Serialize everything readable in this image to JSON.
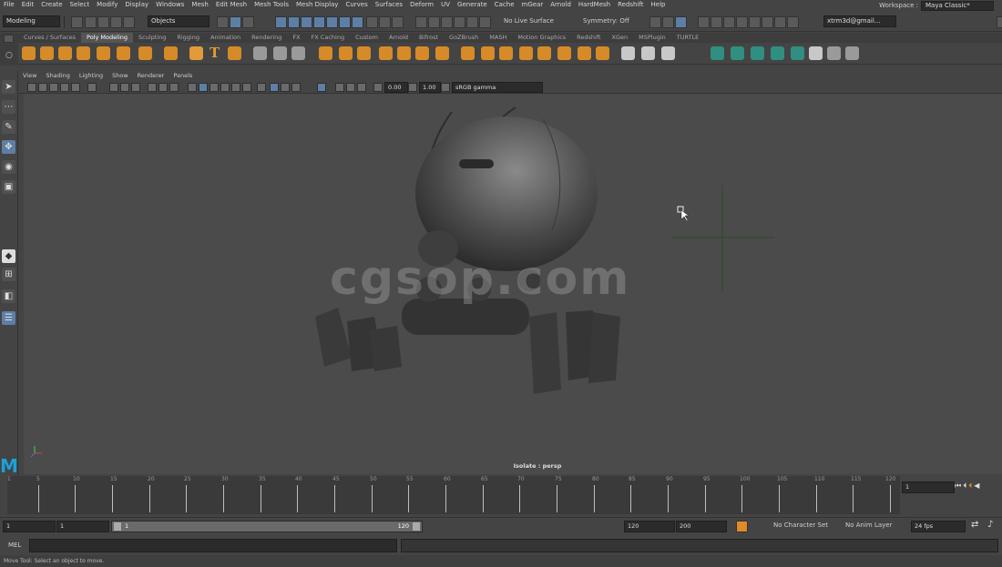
{
  "menu": [
    "File",
    "Edit",
    "Create",
    "Select",
    "Modify",
    "Display",
    "Windows",
    "Mesh",
    "Edit Mesh",
    "Mesh Tools",
    "Mesh Display",
    "Curves",
    "Surfaces",
    "Deform",
    "UV",
    "Generate",
    "Cache",
    "mGear",
    "Arnold",
    "HardMesh",
    "Redshift",
    "Help"
  ],
  "workspace": {
    "label": "Workspace :",
    "value": "Maya Classic*"
  },
  "status": {
    "mode": "Modeling",
    "objects": "Objects",
    "live_surface": "No Live Surface",
    "symmetry": "Symmetry: Off",
    "account": "xtrm3d@gmail..."
  },
  "shelf_tabs": [
    "Curves / Surfaces",
    "Poly Modeling",
    "Sculpting",
    "Rigging",
    "Animation",
    "Rendering",
    "FX",
    "FX Caching",
    "Custom",
    "Arnold",
    "Bifrost",
    "GoZBrush",
    "MASH",
    "Motion Graphics",
    "Redshift",
    "XGen",
    "MSPlugin",
    "TURTLE"
  ],
  "panel_menu": [
    "View",
    "Shading",
    "Lighting",
    "Show",
    "Renderer",
    "Panels"
  ],
  "panel_toolbar": {
    "exposure": "0.00",
    "gamma": "1.00",
    "color_space": "sRGB gamma"
  },
  "viewport": {
    "label": "Isolate : persp",
    "watermark": "cgsop.com"
  },
  "timeline": {
    "ticks": [
      "1",
      "5",
      "10",
      "15",
      "20",
      "25",
      "30",
      "35",
      "40",
      "45",
      "50",
      "55",
      "60",
      "65",
      "70",
      "75",
      "80",
      "85",
      "90",
      "95",
      "100",
      "105",
      "110",
      "115",
      "120"
    ],
    "current_frame": "1"
  },
  "range": {
    "start": "1",
    "anim_start": "1",
    "slider_start": "1",
    "slider_end": "120",
    "end": "120",
    "anim_end": "200",
    "char_set": "No Character Set",
    "anim_layer": "No Anim Layer",
    "fps": "24 fps"
  },
  "cmd": {
    "label": "MEL"
  },
  "help": "Move Tool: Select an object to move."
}
